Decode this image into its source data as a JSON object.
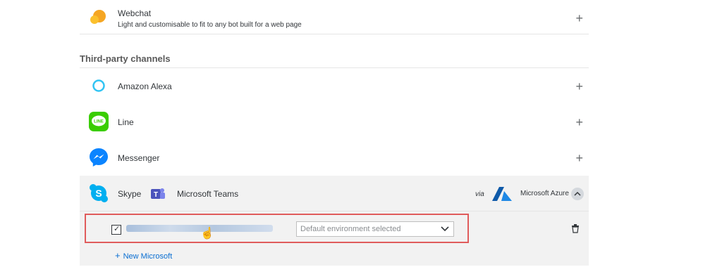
{
  "channels_top": [
    {
      "label": "Webchat",
      "description": "Light and customisable to fit to any bot built for a web page"
    }
  ],
  "third_party_title": "Third-party channels",
  "third_party": [
    {
      "label": "Amazon Alexa"
    },
    {
      "label": "Line"
    },
    {
      "label": "Messenger"
    }
  ],
  "expanded": {
    "skype": "Skype",
    "teams": "Microsoft Teams",
    "via": "via",
    "azure": "Microsoft Azure",
    "dropdown_placeholder": "Default environment selected",
    "new_label": "New Microsoft"
  },
  "colors": {
    "webchat": "#f5a623",
    "alexa": "#31c4f3",
    "line": "#3acd01",
    "messenger": "#0b84ff",
    "skype": "#00aff0",
    "teams": "#4b53bc",
    "azure": "#0f5aa9",
    "link": "#0a6ed1",
    "highlight": "#e05c5c"
  },
  "icons": {
    "webchat": "chat-bubble-icon",
    "alexa": "alexa-ring-icon",
    "line": "line-app-icon",
    "messenger": "messenger-icon",
    "skype": "skype-icon",
    "teams": "teams-icon",
    "azure": "azure-icon",
    "add": "plus-icon",
    "collapse": "chevron-up-icon",
    "delete": "trash-icon",
    "dropdown": "chevron-down-icon"
  }
}
